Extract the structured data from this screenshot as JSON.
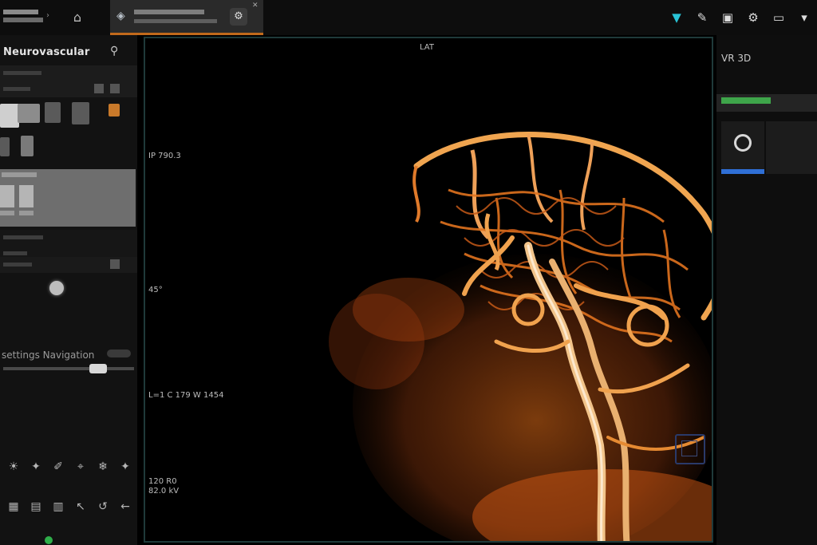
{
  "top_bar": {
    "tools": [
      {
        "icon": "pin-icon",
        "symbol": "▼",
        "color": "#29c3d6"
      },
      {
        "icon": "edit-icon",
        "symbol": "✎"
      },
      {
        "icon": "camera-icon",
        "symbol": "▣"
      },
      {
        "icon": "settings-icon",
        "symbol": "⚙"
      },
      {
        "icon": "monitor-icon",
        "symbol": "▭"
      },
      {
        "icon": "user-icon",
        "symbol": "▾"
      }
    ]
  },
  "task_tab": {
    "icon": "volume-icon",
    "thumb_icon": "gear-icon"
  },
  "left_panel": {
    "title": "Neurovascular",
    "nav_label": "settings Navigation",
    "buttons": [
      "☀",
      "✦",
      "✐",
      "⌖",
      "❄",
      "✦",
      "▦",
      "▤",
      "▥",
      "↖",
      "↺",
      "←"
    ]
  },
  "viewport": {
    "view_label": "LAT",
    "text_lines": [
      "IP 790.3",
      "45°",
      "L=1 C 179 W 1454",
      "120 R0",
      "82.0 kV"
    ]
  },
  "right_panel": {
    "header": "VR 3D",
    "accent_green": "#3ea54a",
    "accent_blue": "#2f6fd6"
  },
  "colors": {
    "vessel_orange": "#e0701c",
    "vessel_light": "#f0b070",
    "background": "#000000"
  }
}
